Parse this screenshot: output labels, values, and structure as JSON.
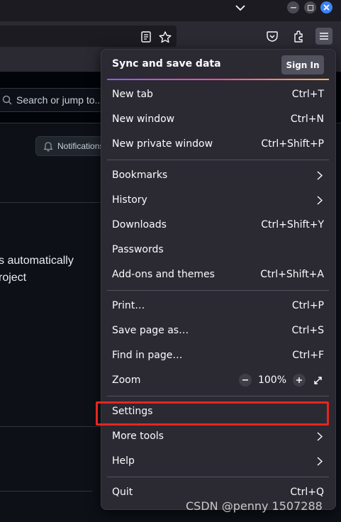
{
  "browser": {
    "icons": {
      "tab_list": "chevron-down-icon",
      "minimize": "minimize-icon",
      "maximize": "maximize-icon",
      "close": "close-icon",
      "reader": "reader-view-icon",
      "bookmark": "star-icon",
      "pocket": "pocket-icon",
      "extensions": "extensions-icon",
      "menu": "hamburger-menu-icon"
    }
  },
  "page": {
    "search_placeholder": "Search or jump to...",
    "notifications_label": "Notifications",
    "body_line1": "s automatically",
    "body_line2": "roject"
  },
  "menu": {
    "sync_title": "Sync and save data",
    "sign_in": "Sign In",
    "items": [
      {
        "label": "New tab",
        "shortcut": "Ctrl+T"
      },
      {
        "label": "New window",
        "shortcut": "Ctrl+N"
      },
      {
        "label": "New private window",
        "shortcut": "Ctrl+Shift+P"
      },
      {
        "label": "Bookmarks",
        "shortcut": ""
      },
      {
        "label": "History",
        "shortcut": ""
      },
      {
        "label": "Downloads",
        "shortcut": "Ctrl+Shift+Y"
      },
      {
        "label": "Passwords",
        "shortcut": ""
      },
      {
        "label": "Add-ons and themes",
        "shortcut": "Ctrl+Shift+A"
      },
      {
        "label": "Print…",
        "shortcut": "Ctrl+P"
      },
      {
        "label": "Save page as…",
        "shortcut": "Ctrl+S"
      },
      {
        "label": "Find in page…",
        "shortcut": "Ctrl+F"
      },
      {
        "label": "Zoom",
        "shortcut": ""
      },
      {
        "label": "Settings",
        "shortcut": ""
      },
      {
        "label": "More tools",
        "shortcut": ""
      },
      {
        "label": "Help",
        "shortcut": ""
      },
      {
        "label": "Quit",
        "shortcut": "Ctrl+Q"
      }
    ],
    "zoom_value": "100%",
    "zoom_minus": "−",
    "zoom_plus": "+"
  },
  "colors": {
    "highlight": "#e5261f",
    "menu_bg": "#2b2a33",
    "page_bg": "#0d1117"
  },
  "watermark": "CSDN @penny 1507288"
}
